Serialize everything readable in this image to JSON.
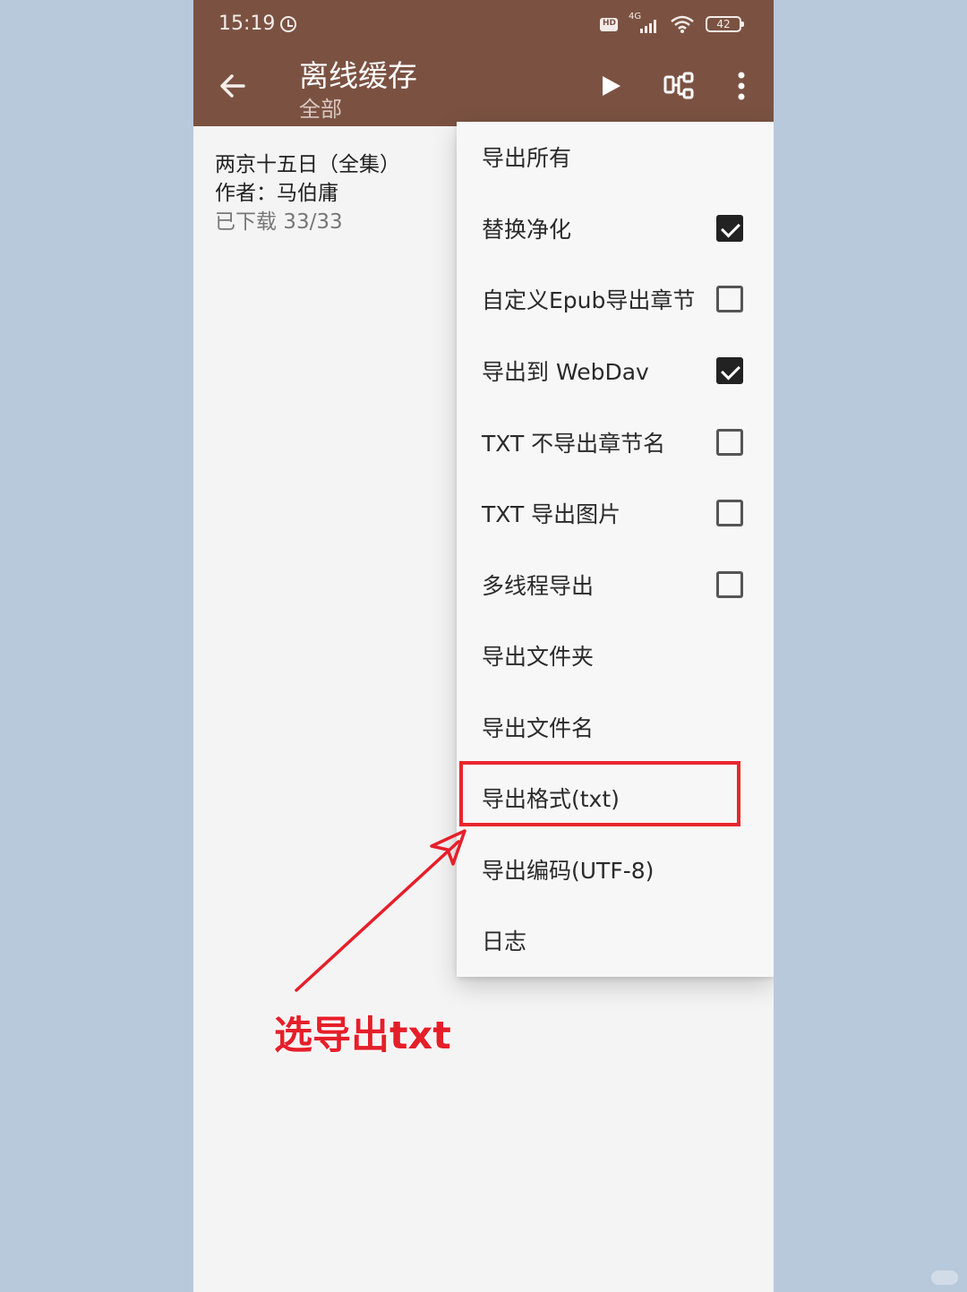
{
  "status_bar": {
    "time": "15:19",
    "network": "4G",
    "battery": "42"
  },
  "app_bar": {
    "title": "离线缓存",
    "subtitle": "全部"
  },
  "book": {
    "title": "两京十五日（全集）",
    "author": "作者：马伯庸",
    "download_status": "已下载 33/33"
  },
  "menu": {
    "items": [
      {
        "label": "导出所有"
      },
      {
        "label": "替换净化",
        "checked": true
      },
      {
        "label": "自定义Epub导出章节",
        "checked": false
      },
      {
        "label": "导出到 WebDav",
        "checked": true
      },
      {
        "label": "TXT 不导出章节名",
        "checked": false
      },
      {
        "label": "TXT 导出图片",
        "checked": false
      },
      {
        "label": "多线程导出",
        "checked": false
      },
      {
        "label": "导出文件夹"
      },
      {
        "label": "导出文件名"
      },
      {
        "label": "导出格式(txt)"
      },
      {
        "label": "导出编码(UTF-8)"
      },
      {
        "label": "日志"
      }
    ]
  },
  "annotation": {
    "text": "选导出txt"
  },
  "colors": {
    "app_bar": "#7b5242",
    "background": "#b8c9dc",
    "annotation_red": "#e51f2a"
  }
}
